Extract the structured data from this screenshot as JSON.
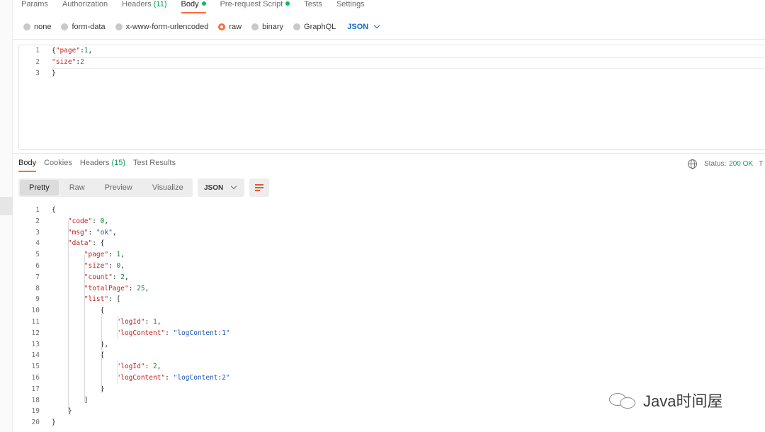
{
  "request_tabs": [
    {
      "label": "Params"
    },
    {
      "label": "Authorization"
    },
    {
      "label": "Headers",
      "count": "(11)"
    },
    {
      "label": "Body",
      "active": true,
      "dot": true
    },
    {
      "label": "Pre-request Script",
      "dot": true
    },
    {
      "label": "Tests"
    },
    {
      "label": "Settings"
    }
  ],
  "body_types": [
    "none",
    "form-data",
    "x-www-form-urlencoded",
    "raw",
    "binary",
    "GraphQL"
  ],
  "body_type_selected": "raw",
  "language": "JSON",
  "request_body": {
    "line_numbers": [
      "1",
      "2",
      "3"
    ],
    "lines": [
      [
        {
          "t": "{",
          "c": "p"
        },
        {
          "t": "\"page\"",
          "c": "k"
        },
        {
          "t": ":",
          "c": "p"
        },
        {
          "t": "1",
          "c": "n"
        },
        {
          "t": ",",
          "c": "p"
        }
      ],
      [
        {
          "t": "\"size\"",
          "c": "k"
        },
        {
          "t": ":",
          "c": "p"
        },
        {
          "t": "2",
          "c": "n"
        }
      ],
      [
        {
          "t": "}",
          "c": "p"
        }
      ]
    ]
  },
  "response_tabs": [
    {
      "label": "Body",
      "active": true
    },
    {
      "label": "Cookies"
    },
    {
      "label": "Headers",
      "count": "(15)"
    },
    {
      "label": "Test Results"
    }
  ],
  "status": {
    "label": "Status:",
    "value": "200 OK",
    "trailing": "T"
  },
  "view_modes": [
    "Pretty",
    "Raw",
    "Preview",
    "Visualize"
  ],
  "view_mode_selected": "Pretty",
  "format": "JSON",
  "icons": {
    "globe": "globe-icon",
    "wrap": "wrap-lines-icon",
    "chevron": "chevron-down-icon"
  },
  "accent_color": "#ff6c37",
  "response_body": {
    "line_numbers": [
      "1",
      "2",
      "3",
      "4",
      "5",
      "6",
      "7",
      "8",
      "9",
      "10",
      "11",
      "12",
      "13",
      "14",
      "15",
      "16",
      "17",
      "18",
      "19",
      "20"
    ],
    "lines": [
      [
        {
          "t": "{",
          "c": "p"
        }
      ],
      [
        {
          "t": "    ",
          "c": "p"
        },
        {
          "t": "\"code\"",
          "c": "k"
        },
        {
          "t": ": ",
          "c": "p"
        },
        {
          "t": "0",
          "c": "n"
        },
        {
          "t": ",",
          "c": "p"
        }
      ],
      [
        {
          "t": "    ",
          "c": "p"
        },
        {
          "t": "\"msg\"",
          "c": "k"
        },
        {
          "t": ": ",
          "c": "p"
        },
        {
          "t": "\"ok\"",
          "c": "s"
        },
        {
          "t": ",",
          "c": "p"
        }
      ],
      [
        {
          "t": "    ",
          "c": "p"
        },
        {
          "t": "\"data\"",
          "c": "k"
        },
        {
          "t": ": {",
          "c": "p"
        }
      ],
      [
        {
          "t": "        ",
          "c": "p"
        },
        {
          "t": "\"page\"",
          "c": "k"
        },
        {
          "t": ": ",
          "c": "p"
        },
        {
          "t": "1",
          "c": "n"
        },
        {
          "t": ",",
          "c": "p"
        }
      ],
      [
        {
          "t": "        ",
          "c": "p"
        },
        {
          "t": "\"size\"",
          "c": "k"
        },
        {
          "t": ": ",
          "c": "p"
        },
        {
          "t": "0",
          "c": "n"
        },
        {
          "t": ",",
          "c": "p"
        }
      ],
      [
        {
          "t": "        ",
          "c": "p"
        },
        {
          "t": "\"count\"",
          "c": "k"
        },
        {
          "t": ": ",
          "c": "p"
        },
        {
          "t": "2",
          "c": "n"
        },
        {
          "t": ",",
          "c": "p"
        }
      ],
      [
        {
          "t": "        ",
          "c": "p"
        },
        {
          "t": "\"totalPage\"",
          "c": "k"
        },
        {
          "t": ": ",
          "c": "p"
        },
        {
          "t": "25",
          "c": "n"
        },
        {
          "t": ",",
          "c": "p"
        }
      ],
      [
        {
          "t": "        ",
          "c": "p"
        },
        {
          "t": "\"list\"",
          "c": "k"
        },
        {
          "t": ": [",
          "c": "p"
        }
      ],
      [
        {
          "t": "            {",
          "c": "p"
        }
      ],
      [
        {
          "t": "                ",
          "c": "p"
        },
        {
          "t": "\"logId\"",
          "c": "k"
        },
        {
          "t": ": ",
          "c": "p"
        },
        {
          "t": "1",
          "c": "n"
        },
        {
          "t": ",",
          "c": "p"
        }
      ],
      [
        {
          "t": "                ",
          "c": "p"
        },
        {
          "t": "\"logContent\"",
          "c": "k"
        },
        {
          "t": ": ",
          "c": "p"
        },
        {
          "t": "\"logContent:1\"",
          "c": "s"
        }
      ],
      [
        {
          "t": "            },",
          "c": "p"
        }
      ],
      [
        {
          "t": "            {",
          "c": "p"
        }
      ],
      [
        {
          "t": "                ",
          "c": "p"
        },
        {
          "t": "\"logId\"",
          "c": "k"
        },
        {
          "t": ": ",
          "c": "p"
        },
        {
          "t": "2",
          "c": "n"
        },
        {
          "t": ",",
          "c": "p"
        }
      ],
      [
        {
          "t": "                ",
          "c": "p"
        },
        {
          "t": "\"logContent\"",
          "c": "k"
        },
        {
          "t": ": ",
          "c": "p"
        },
        {
          "t": "\"logContent:2\"",
          "c": "s"
        }
      ],
      [
        {
          "t": "            }",
          "c": "p"
        }
      ],
      [
        {
          "t": "        ]",
          "c": "p"
        }
      ],
      [
        {
          "t": "    }",
          "c": "p"
        }
      ],
      [
        {
          "t": "}",
          "c": "p"
        }
      ]
    ]
  },
  "watermark": {
    "text": "Java时间屋",
    "icon": "wechat-icon"
  }
}
